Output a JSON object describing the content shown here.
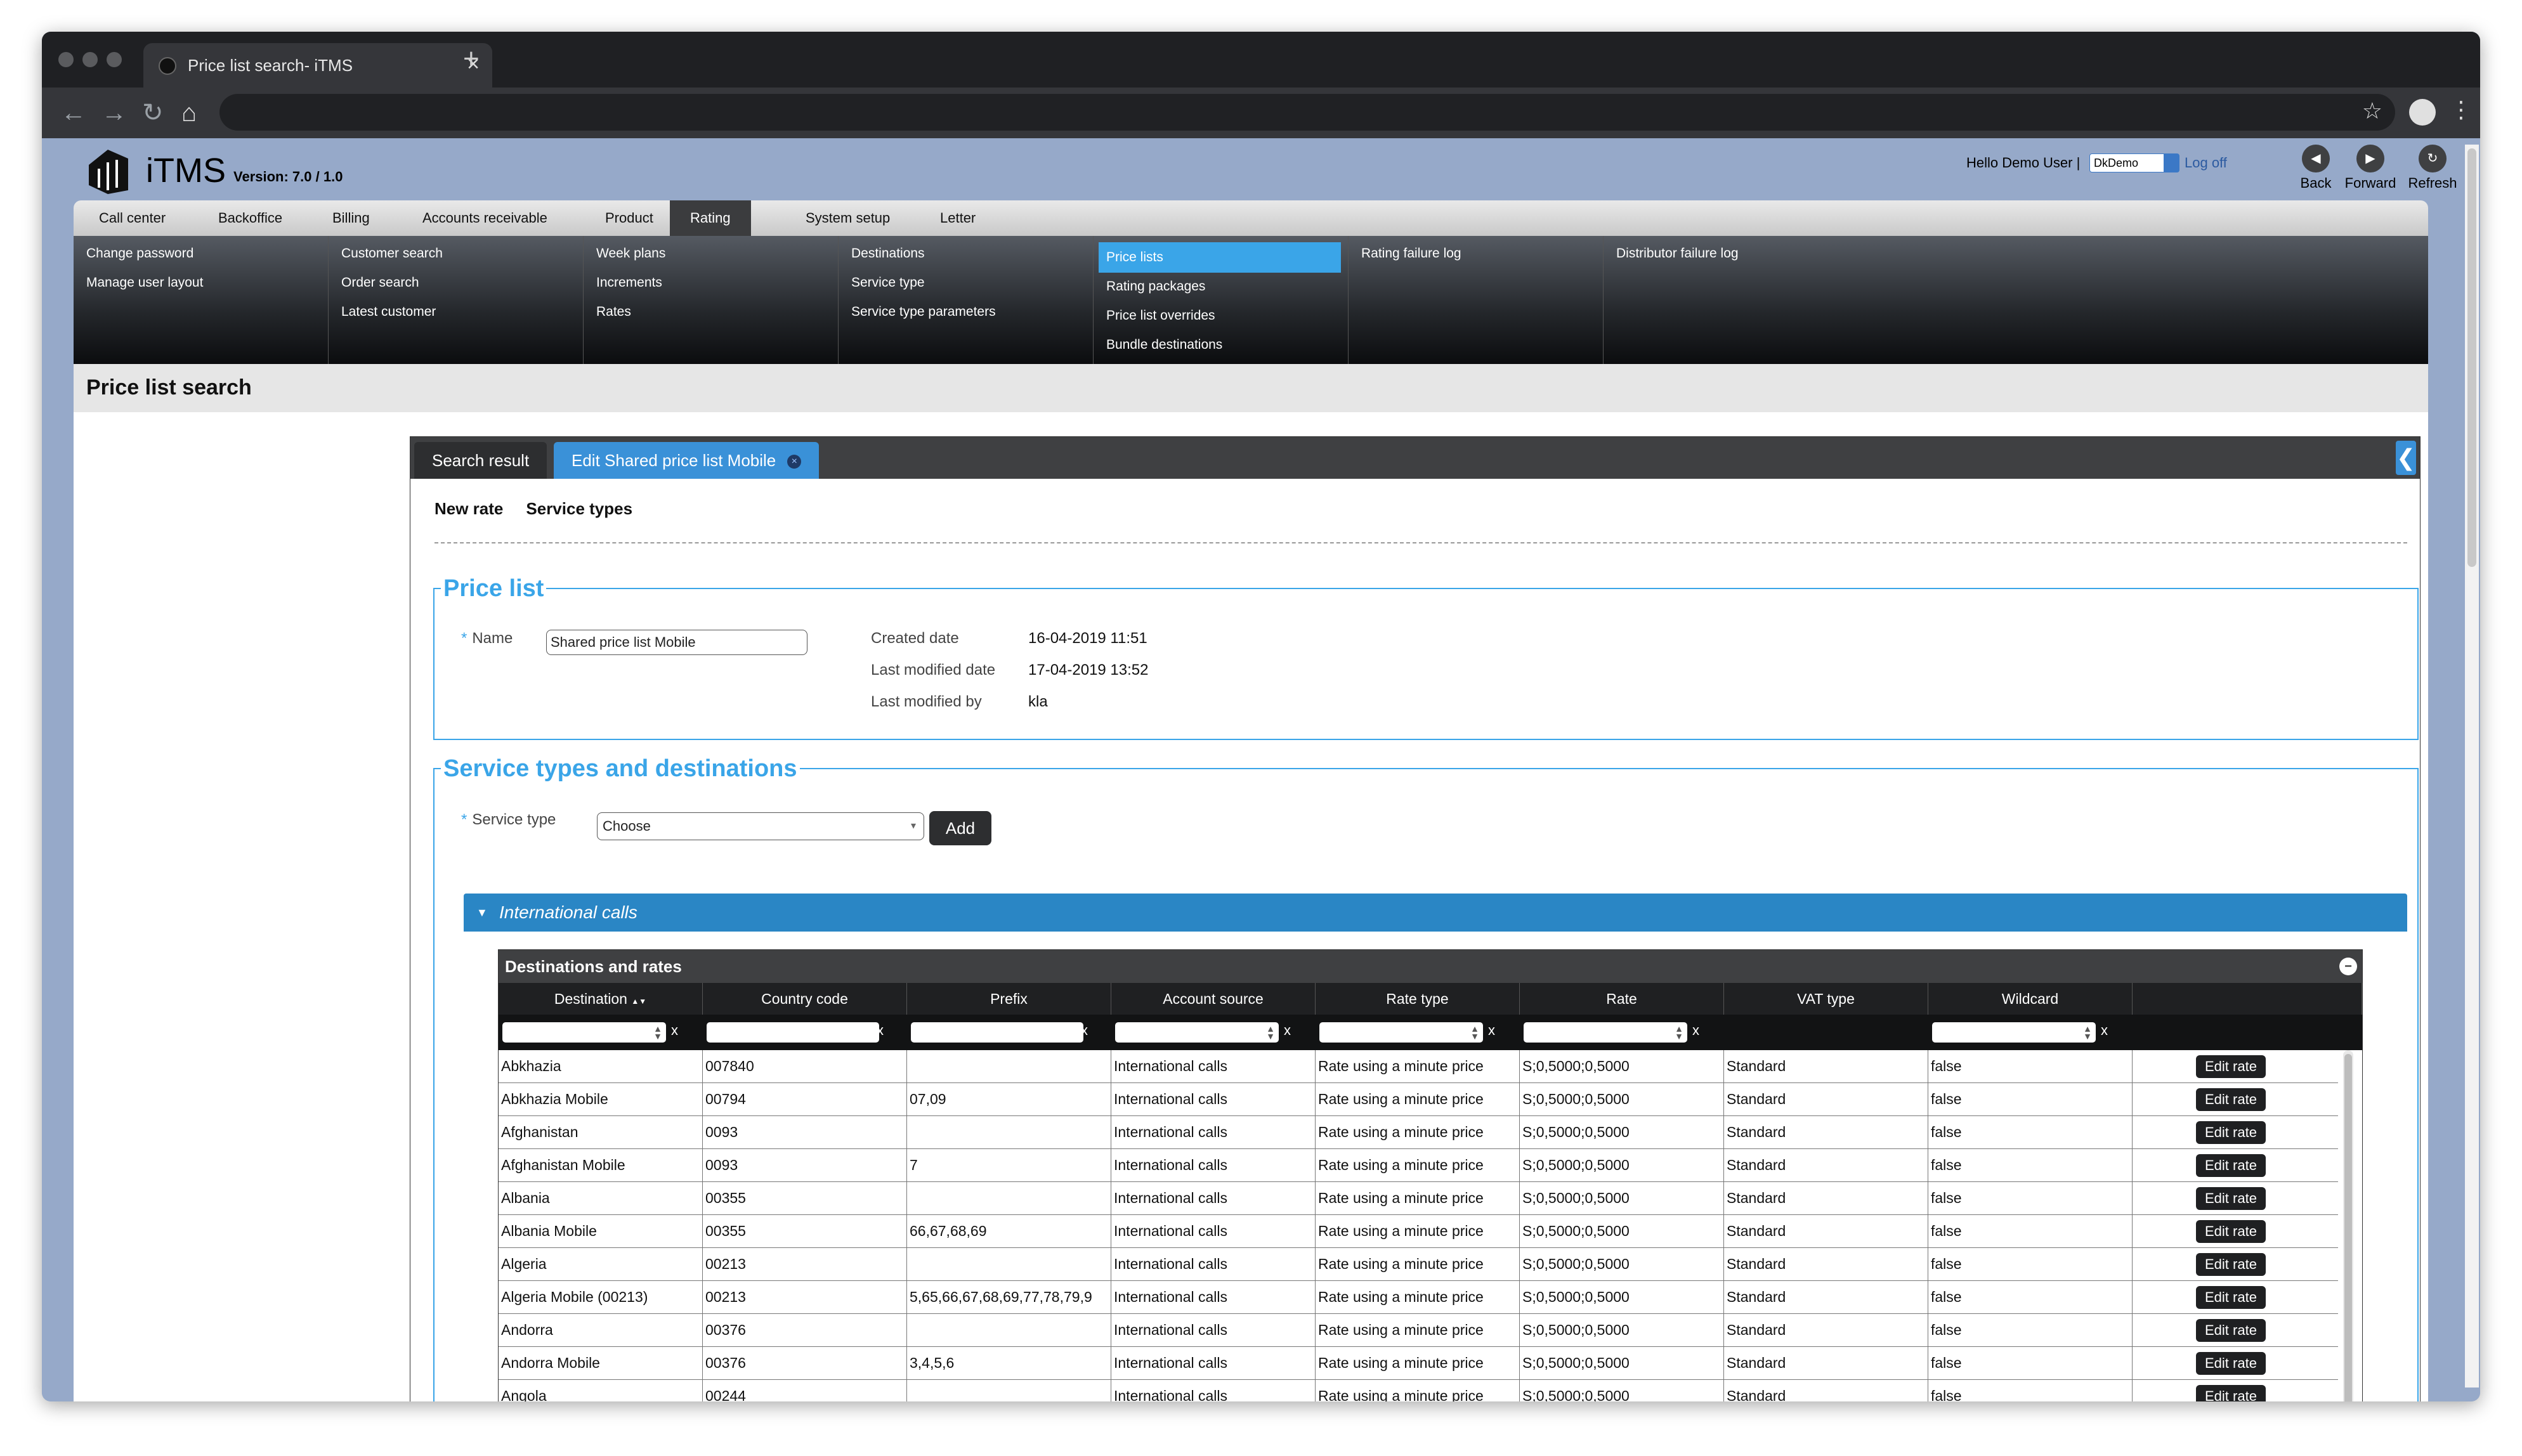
{
  "browser": {
    "tab_title": "Price list search- iTMS",
    "new_tab_symbol": "+",
    "close_symbol": "×"
  },
  "app": {
    "logo_text": "iTMS",
    "version": "Version: 7.0 / 1.0",
    "greeting": "Hello Demo User |",
    "customer_select": "DkDemo",
    "separator": "|",
    "logoff": "Log off",
    "back": "Back",
    "forward": "Forward",
    "refresh": "Refresh"
  },
  "mainnav": [
    "Call center",
    "Backoffice",
    "Billing",
    "Accounts receivable",
    "Product",
    "Rating",
    "System setup",
    "Letter"
  ],
  "mainnav_active": "Rating",
  "submenu": {
    "col1": [
      "Change password",
      "Manage user layout"
    ],
    "col2": [
      "Customer search",
      "Order search",
      "Latest customer"
    ],
    "col3": [
      "Week plans",
      "Increments",
      "Rates"
    ],
    "col4": [
      "Destinations",
      "Service type",
      "Service type parameters"
    ],
    "col5": [
      "Price lists",
      "Rating packages",
      "Price list overrides",
      "Bundle destinations"
    ],
    "col6": [
      "Rating failure log"
    ],
    "col7": [
      "Distributor failure log"
    ],
    "active": "Price lists"
  },
  "page": {
    "title": "Price list search",
    "tabs": [
      "Search result",
      "Edit Shared price list Mobile"
    ],
    "tab_close": "×",
    "collapse": "❮",
    "toolbar": [
      "New rate",
      "Service types"
    ]
  },
  "price_list": {
    "legend": "Price list",
    "name_label": "Name",
    "name_value": "Shared price list Mobile",
    "created_label": "Created date",
    "created_value": "16-04-2019 11:51",
    "modified_label": "Last modified date",
    "modified_value": "17-04-2019 13:52",
    "modified_by_label": "Last modified by",
    "modified_by_value": "kla"
  },
  "service_types": {
    "legend": "Service types and destinations",
    "service_type_label": "Service type",
    "service_type_value": "Choose",
    "add_label": "Add",
    "accordion_title": "International calls"
  },
  "grid": {
    "title": "Destinations and rates",
    "columns": [
      "Destination",
      "Country code",
      "Prefix",
      "Account source",
      "Rate type",
      "Rate",
      "VAT type",
      "Wildcard",
      ""
    ],
    "sort_indicator": "▲▼",
    "filter_clear": "x",
    "edit_label": "Edit rate",
    "rows": [
      [
        "Abkhazia",
        "007840",
        "",
        "International calls",
        "Rate using a minute price",
        "S;0,5000;0,5000",
        "Standard",
        "false"
      ],
      [
        "Abkhazia Mobile",
        "00794",
        "07,09",
        "International calls",
        "Rate using a minute price",
        "S;0,5000;0,5000",
        "Standard",
        "false"
      ],
      [
        "Afghanistan",
        "0093",
        "",
        "International calls",
        "Rate using a minute price",
        "S;0,5000;0,5000",
        "Standard",
        "false"
      ],
      [
        "Afghanistan Mobile",
        "0093",
        "7",
        "International calls",
        "Rate using a minute price",
        "S;0,5000;0,5000",
        "Standard",
        "false"
      ],
      [
        "Albania",
        "00355",
        "",
        "International calls",
        "Rate using a minute price",
        "S;0,5000;0,5000",
        "Standard",
        "false"
      ],
      [
        "Albania Mobile",
        "00355",
        "66,67,68,69",
        "International calls",
        "Rate using a minute price",
        "S;0,5000;0,5000",
        "Standard",
        "false"
      ],
      [
        "Algeria",
        "00213",
        "",
        "International calls",
        "Rate using a minute price",
        "S;0,5000;0,5000",
        "Standard",
        "false"
      ],
      [
        "Algeria Mobile (00213)",
        "00213",
        "5,65,66,67,68,69,77,78,79,9",
        "International calls",
        "Rate using a minute price",
        "S;0,5000;0,5000",
        "Standard",
        "false"
      ],
      [
        "Andorra",
        "00376",
        "",
        "International calls",
        "Rate using a minute price",
        "S;0,5000;0,5000",
        "Standard",
        "false"
      ],
      [
        "Andorra Mobile",
        "00376",
        "3,4,5,6",
        "International calls",
        "Rate using a minute price",
        "S;0,5000;0,5000",
        "Standard",
        "false"
      ],
      [
        "Angola",
        "00244",
        "",
        "International calls",
        "Rate using a minute price",
        "S;0,5000;0,5000",
        "Standard",
        "false"
      ]
    ]
  },
  "colors": {
    "accent": "#3aa5e8",
    "accordion": "#2a86c5",
    "dark": "#1f2022"
  }
}
